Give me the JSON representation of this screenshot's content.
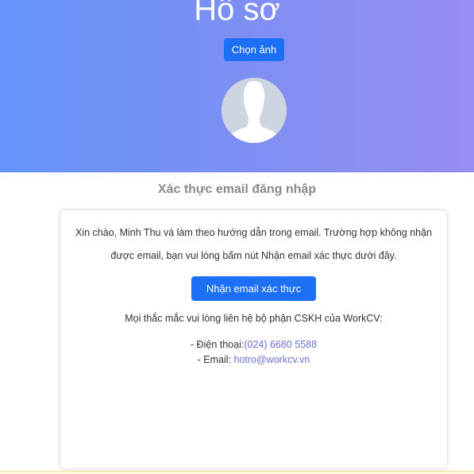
{
  "header": {
    "title": "Hồ sơ",
    "choose_photo_label": "Chọn ảnh",
    "colors": {
      "gradient_start": "#6394fb",
      "gradient_end": "#978cf1"
    }
  },
  "avatar": {
    "icon": "default-user-avatar-icon"
  },
  "section": {
    "heading": "Xác thực email đăng nhập"
  },
  "card": {
    "intro_line1": "Xin chào, Minh Thu và làm theo hướng dẫn trong email. Trường hợp không nhận",
    "intro_line2": "được email, bạn vui lòng bấm nút Nhận email xác thực dưới đây.",
    "confirm_button_label": "Nhận email xác thực",
    "support_text": "Mọi thắc mắc vui lòng liên hệ bộ phận CSKH của WorkCV:",
    "phone_label": "- Điện thoại:",
    "phone_value": "(024) 6680 5588",
    "email_label": "- Email: ",
    "email_value": "hotro@workcv.vn"
  },
  "colors": {
    "primary_button": "#1d6ff5",
    "link": "#6a74d6",
    "heading_gray": "#8a8a8a"
  }
}
